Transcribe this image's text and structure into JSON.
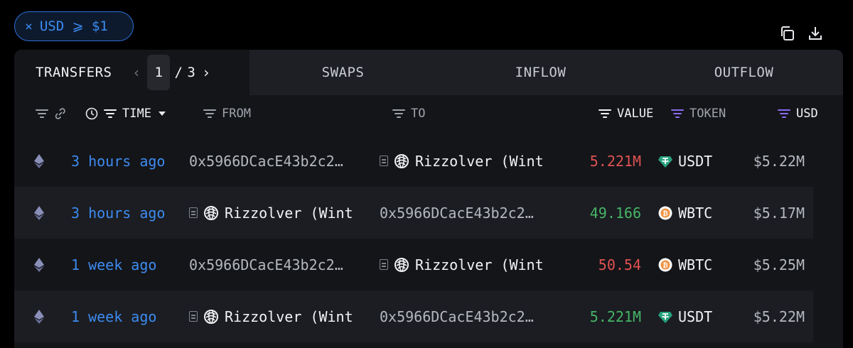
{
  "filter_chip": {
    "close": "×",
    "label": "USD ⩾ $1"
  },
  "tabs": {
    "transfers": "TRANSFERS",
    "pager": {
      "prev": "‹",
      "current": "1",
      "sep": "/",
      "total": "3",
      "next": "›"
    },
    "swaps": "SWAPS",
    "inflow": "INFLOW",
    "outflow": "OUTFLOW"
  },
  "columns": {
    "time": "TIME",
    "from": "FROM",
    "to": "TO",
    "value": "VALUE",
    "token": "TOKEN",
    "usd": "USD"
  },
  "rows": [
    {
      "time": "3 hours ago",
      "from": "0x5966DCacE43b2c2…",
      "from_entity": "",
      "to": "",
      "to_entity": "Rizzolver (Wint",
      "value": "5.221M",
      "value_color": "#e05252",
      "token": "USDT",
      "token_icon": "tether-icon",
      "usd": "$5.22M"
    },
    {
      "time": "3 hours ago",
      "from": "",
      "from_entity": "Rizzolver (Wint",
      "to": "0x5966DCacE43b2c2…",
      "to_entity": "",
      "value": "49.166",
      "value_color": "#46b566",
      "token": "WBTC",
      "token_icon": "wbtc-icon",
      "usd": "$5.17M"
    },
    {
      "time": "1 week ago",
      "from": "0x5966DCacE43b2c2…",
      "from_entity": "",
      "to": "",
      "to_entity": "Rizzolver (Wint",
      "value": "50.54",
      "value_color": "#e05252",
      "token": "WBTC",
      "token_icon": "wbtc-icon",
      "usd": "$5.25M"
    },
    {
      "time": "1 week ago",
      "from": "",
      "from_entity": "Rizzolver (Wint",
      "to": "0x5966DCacE43b2c2…",
      "to_entity": "",
      "value": "5.221M",
      "value_color": "#46b566",
      "token": "USDT",
      "token_icon": "tether-icon",
      "usd": "$5.22M"
    }
  ]
}
